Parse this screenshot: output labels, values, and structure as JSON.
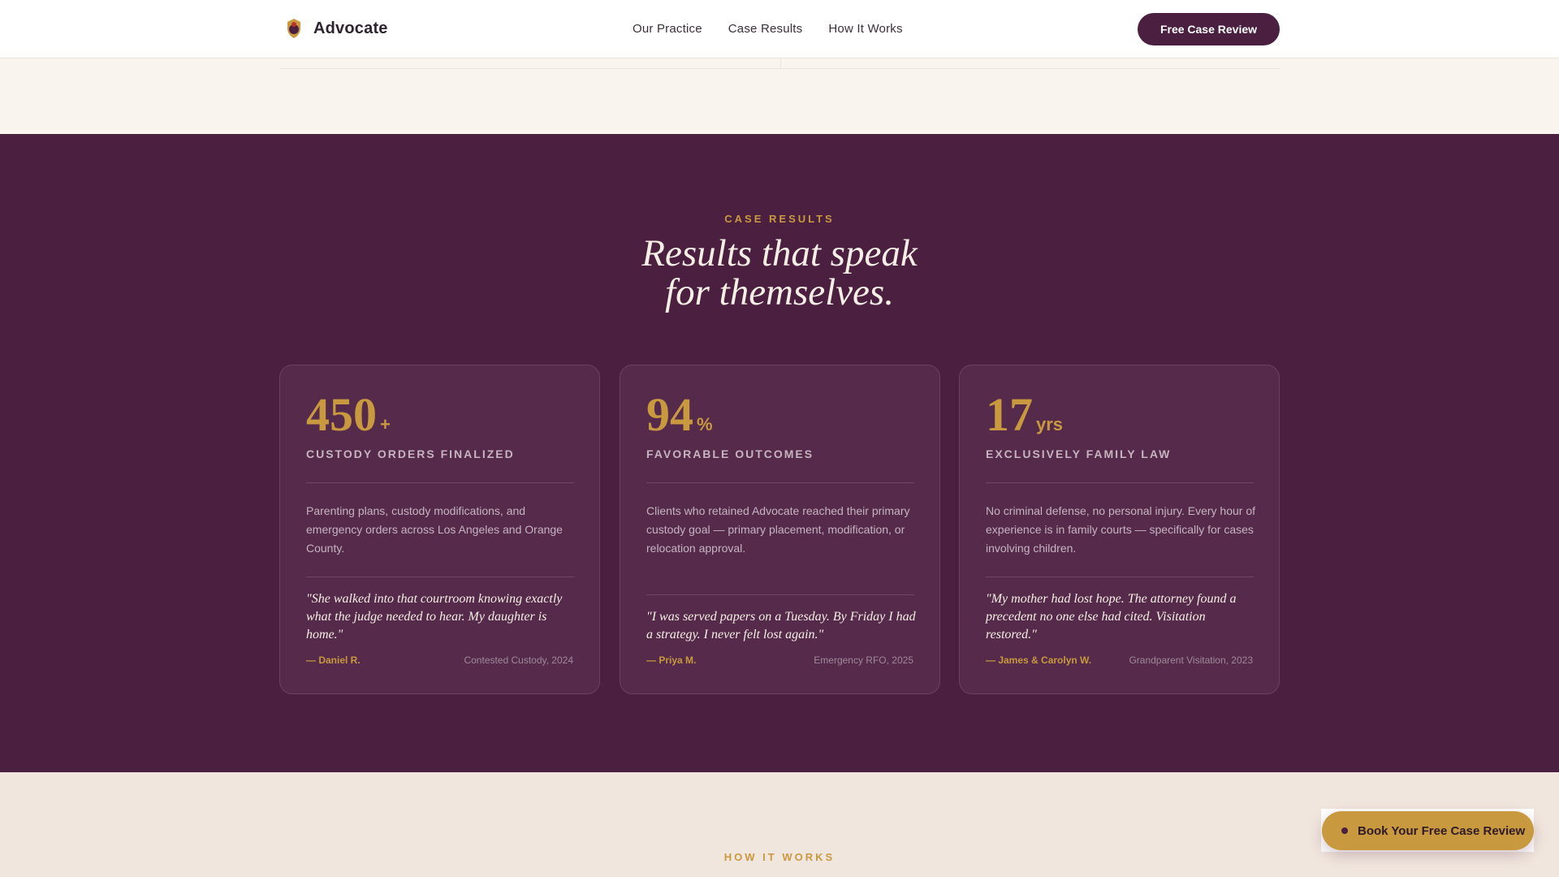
{
  "header": {
    "brand": "Advocate",
    "nav": [
      "Our Practice",
      "Case Results",
      "How It Works"
    ],
    "cta": "Free Case Review"
  },
  "results": {
    "eyebrow": "CASE RESULTS",
    "title_line1": "Results that speak",
    "title_line2": "for themselves.",
    "cards": [
      {
        "number": "450",
        "suffix": "+",
        "label": "CUSTODY ORDERS FINALIZED",
        "description": "Parenting plans, custody modifications, and emergency orders across Los Angeles and Orange County.",
        "quote": "\"She walked into that courtroom knowing exactly what the judge needed to hear. My daughter is home.\"",
        "author": "— Daniel R.",
        "case": "Contested Custody, 2024"
      },
      {
        "number": "94",
        "suffix": "%",
        "label": "FAVORABLE OUTCOMES",
        "description": "Clients who retained Advocate reached their primary custody goal — primary placement, modification, or relocation approval.",
        "quote": "\"I was served papers on a Tuesday. By Friday I had a strategy. I never felt lost again.\"",
        "author": "— Priya M.",
        "case": "Emergency RFO, 2025"
      },
      {
        "number": "17",
        "suffix": "yrs",
        "label": "EXCLUSIVELY FAMILY LAW",
        "description": "No criminal defense, no personal injury. Every hour of experience is in family courts — specifically for cases involving children.",
        "quote": "\"My mother had lost hope. The attorney found a precedent no one else had cited. Visitation restored.\"",
        "author": "— James & Carolyn W.",
        "case": "Grandparent Visitation, 2023"
      }
    ]
  },
  "how_it_works": {
    "eyebrow": "HOW IT WORKS"
  },
  "floating_cta": {
    "label": "Book Your Free Case Review"
  },
  "colors": {
    "plum": "#4a1f40",
    "gold": "#c9993f",
    "cream": "#f9f4ee"
  }
}
